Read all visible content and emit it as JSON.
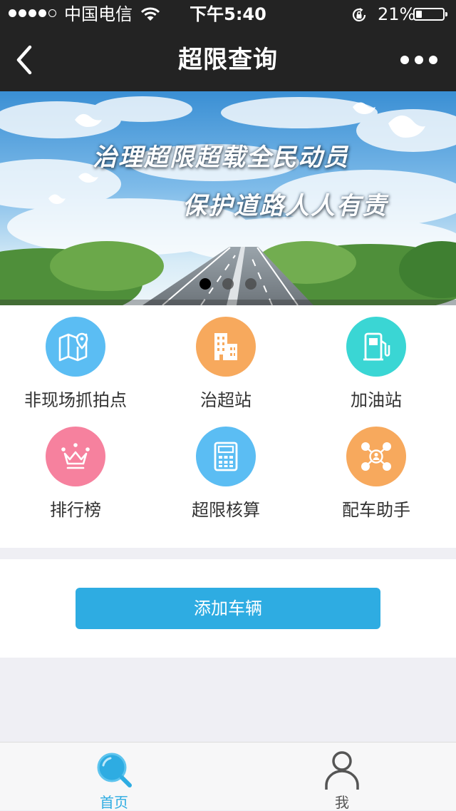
{
  "status_bar": {
    "carrier": "中国电信",
    "time": "下午5:40",
    "battery": "21%",
    "battery_level": 0.21,
    "signal_bars_filled": 4,
    "signal_bars_total": 5
  },
  "nav": {
    "title": "超限查询",
    "back_icon": "chevron-left-icon",
    "more_icon": "more-dots-icon"
  },
  "banner": {
    "slogan_line1": "治理超限超载全民动员",
    "slogan_line2": "保护道路人人有责",
    "slide_count": 3,
    "active_slide": 1
  },
  "grid": {
    "items": [
      {
        "label": "非现场抓拍点",
        "icon": "map-pin-icon",
        "color": "#5bbdf3"
      },
      {
        "label": "治超站",
        "icon": "building-icon",
        "color": "#f7a95d"
      },
      {
        "label": "加油站",
        "icon": "gas-pump-icon",
        "color": "#3ad6d4"
      },
      {
        "label": "排行榜",
        "icon": "crown-icon",
        "color": "#f6819e"
      },
      {
        "label": "超限核算",
        "icon": "calculator-icon",
        "color": "#5bbdf3"
      },
      {
        "label": "配车助手",
        "icon": "network-icon",
        "color": "#f7a95d"
      }
    ]
  },
  "add_vehicle": {
    "label": "添加车辆",
    "color": "#2eace2"
  },
  "tabbar": {
    "tabs": [
      {
        "label": "首页",
        "icon": "search-icon",
        "active": true
      },
      {
        "label": "我",
        "icon": "user-icon",
        "active": false
      }
    ],
    "active_color": "#2eace2"
  }
}
